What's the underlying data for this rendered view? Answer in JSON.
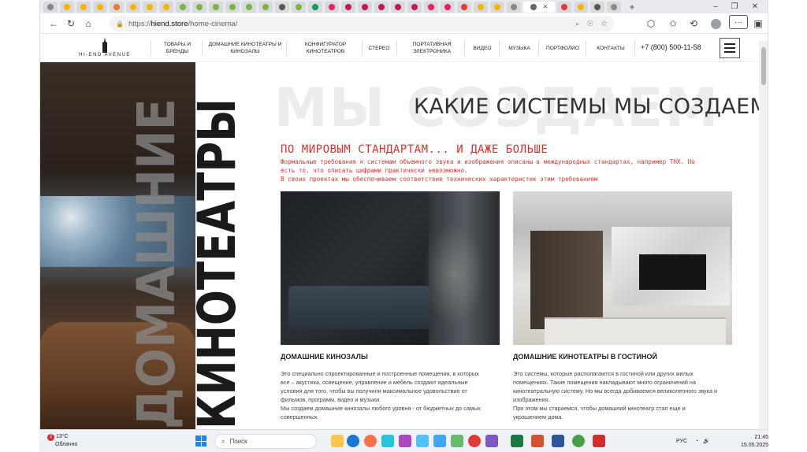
{
  "browser": {
    "active_tab_label": "",
    "url_host": "hiend.store",
    "url_path": "/home-cinema/",
    "url_scheme": "https://"
  },
  "site": {
    "logo_text": "HI-END AVENUE",
    "nav": [
      {
        "label": "Товары и бренды"
      },
      {
        "label": "Домашние кинотеатры и кинозалы"
      },
      {
        "label": "Конфигуратор кинотеатров"
      },
      {
        "label": "Стерео"
      },
      {
        "label": "Портативная электроника"
      },
      {
        "label": "Видео"
      },
      {
        "label": "Музыка"
      },
      {
        "label": "Портфолио"
      },
      {
        "label": "Контакты"
      }
    ],
    "phone": "+7 (800) 500-11-58"
  },
  "hero": {
    "vertical_line1": "ДОМАШНИЕ",
    "vertical_line2": "КИНОТЕАТРЫ"
  },
  "section": {
    "bg_word": "МЫ СОЗДАЕМ",
    "title": "КАКИЕ СИСТЕМЫ МЫ СОЗДАЕМ",
    "subtitle": "ПО МИРОВЫМ СТАНДАРТАМ... И ДАЖЕ БОЛЬШЕ",
    "lines": [
      "Формальные требования к системам объемного звука и изображения описаны в международных стандартах, например THX. Но",
      "есть то, что описать цифрами практически невозможно.",
      "В своих проектах мы обеспечиваем соответствие технических характеристик этим требованиям"
    ]
  },
  "cards": [
    {
      "title": "Домашние кинозалы",
      "lines": [
        "Это специально спроектированные и построенные помещения, в которых",
        "все – акустика, освещение, управление и мебель создают идеальные",
        "условия для того, чтобы вы получили максимальное удовольствие от",
        "фильмов, программ, видео и музыки.",
        "Мы создаем домашние кинозалы любого уровня - от бюджетных до самых",
        "совершенных."
      ]
    },
    {
      "title": "Домашние кинотеатры в гостиной",
      "lines": [
        "Это системы, которые располагаются в гостиной или других жилых",
        "помещениях. Такие помещения накладывают много ограничений на",
        "кинотеатральную систему. Но мы всегда добиваемся великолепного звука и",
        "изображения.",
        "При этом мы стараемся, чтобы домашний кинотеатр стал еще и",
        "украшением дома."
      ]
    }
  ],
  "taskbar": {
    "weather_temp": "13°C",
    "weather_desc": "Облачно",
    "weather_badge": "2",
    "search_placeholder": "Поиск",
    "lang": "РУС",
    "time": "21:45",
    "date": "15.05.2025"
  },
  "colors": {
    "accent_red": "#e0322c",
    "text_dark": "#222222"
  }
}
